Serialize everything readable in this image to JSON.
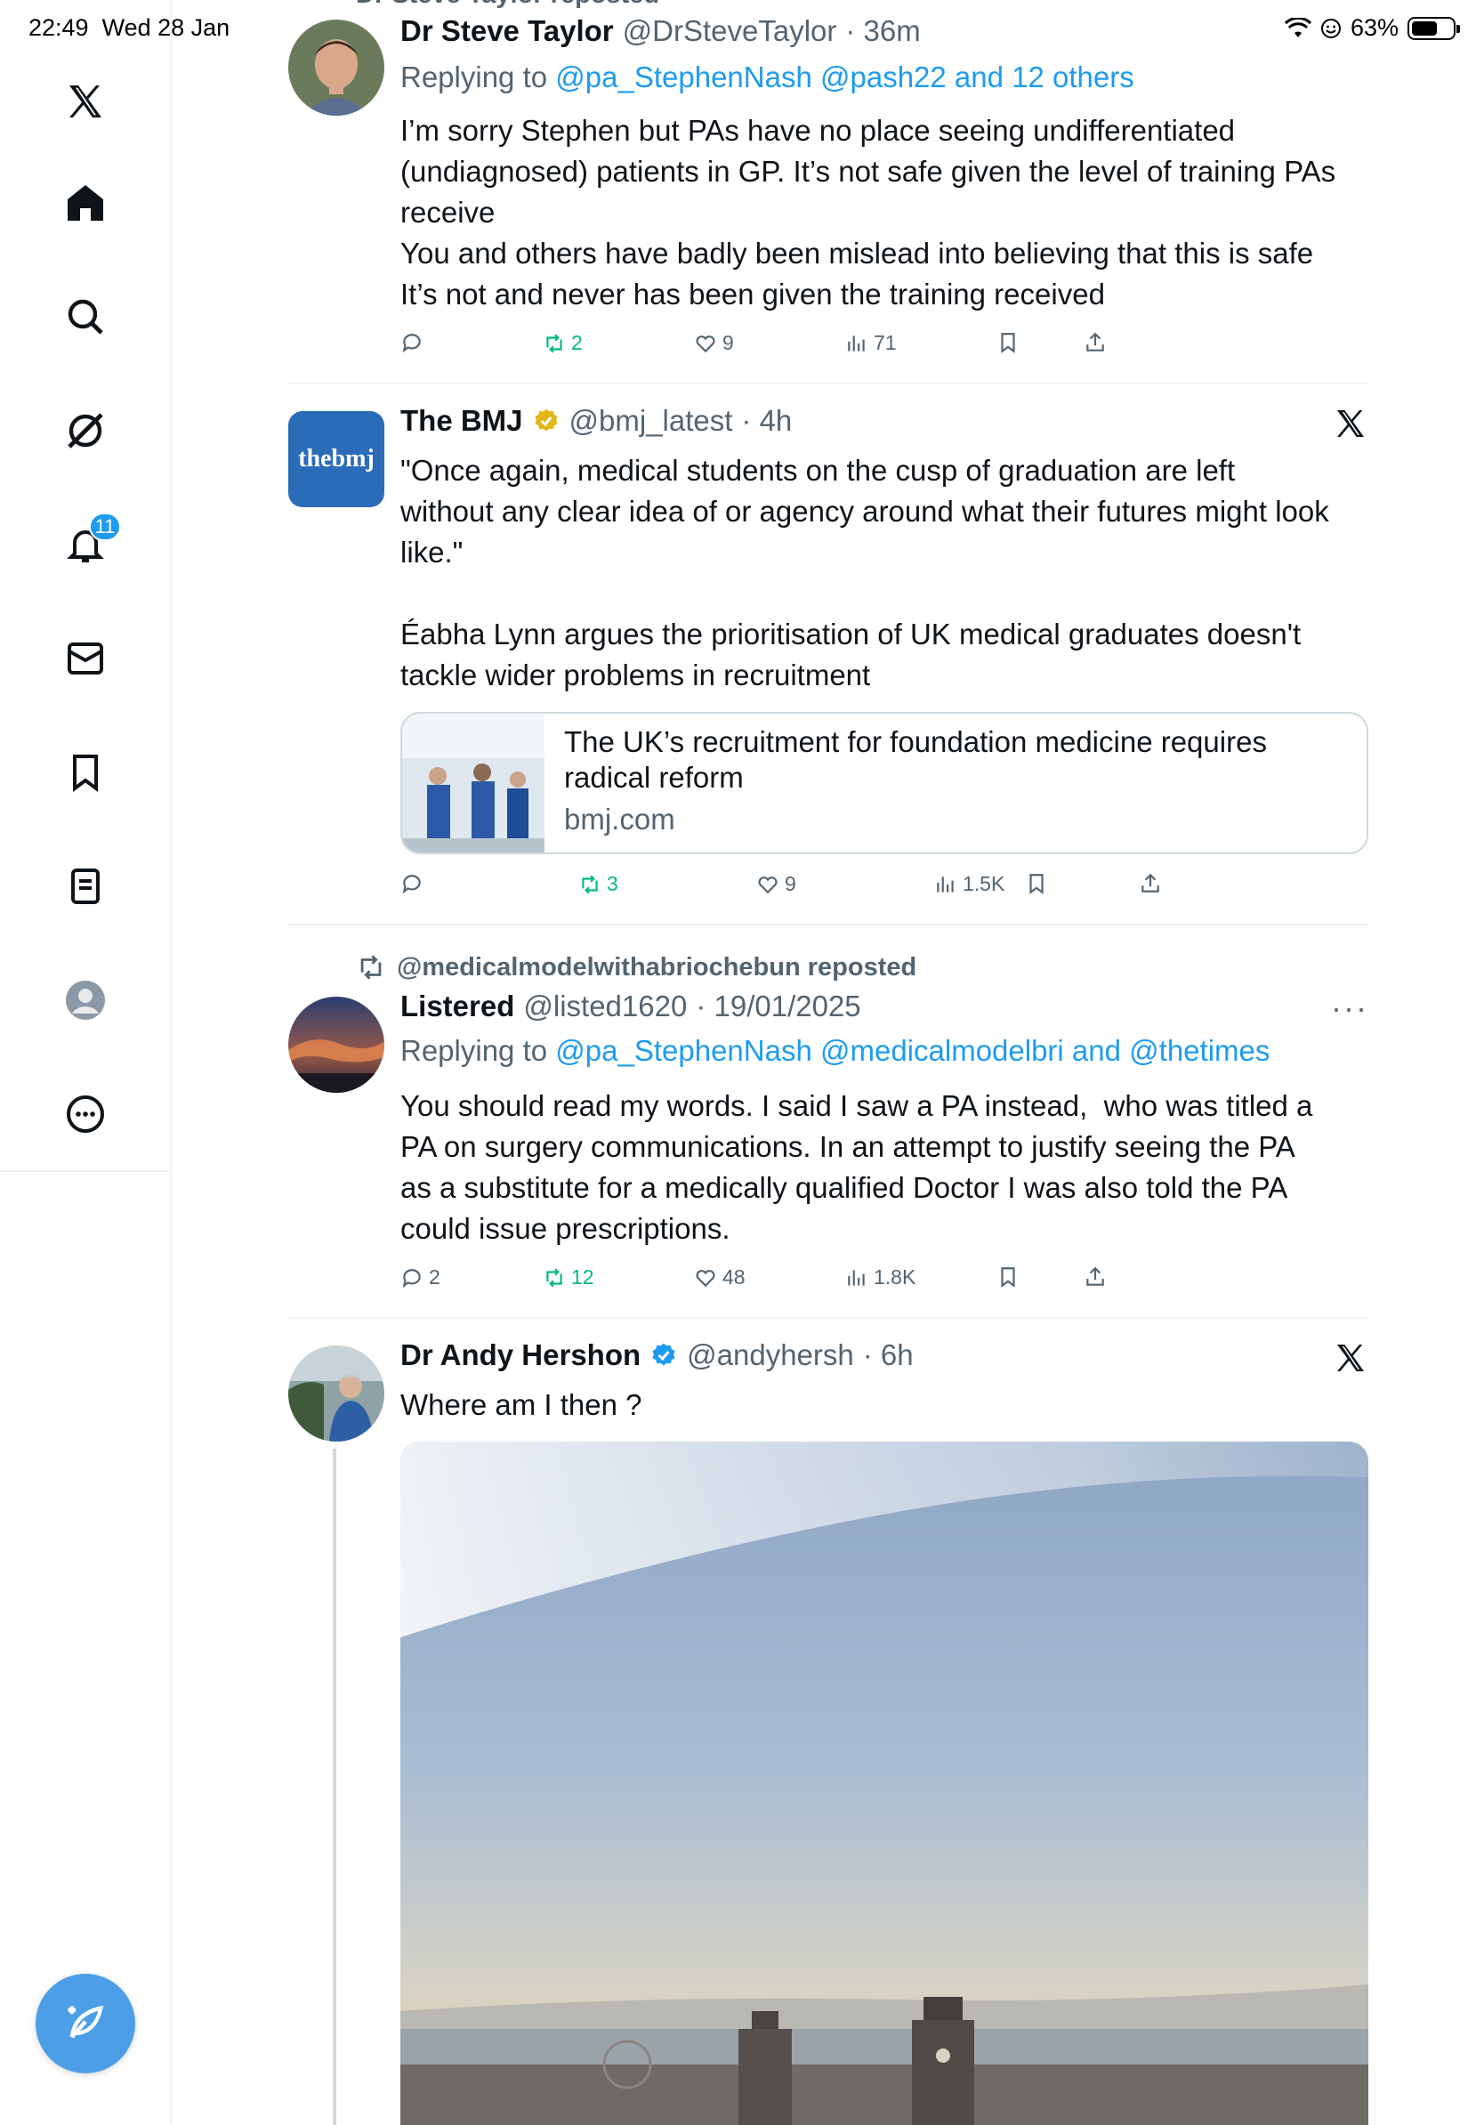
{
  "status": {
    "time": "22:49",
    "date": "Wed 28 Jan",
    "battery": "63%",
    "battery_level": 0.63
  },
  "sidebar": {
    "items": [
      {
        "name": "x-logo"
      },
      {
        "name": "home"
      },
      {
        "name": "search"
      },
      {
        "name": "grok"
      },
      {
        "name": "notifications",
        "badge": "11"
      },
      {
        "name": "messages"
      },
      {
        "name": "bookmarks"
      },
      {
        "name": "lists"
      },
      {
        "name": "profile"
      },
      {
        "name": "more"
      }
    ]
  },
  "tweets": [
    {
      "context": "Dr Steve Taylor reposted",
      "name": "Dr Steve Taylor",
      "handle": "@DrSteveTaylor",
      "time": "· 36m",
      "reply_prefix": "Replying to",
      "reply_to": "@pa_StephenNash @pash22 and 12 others",
      "text": "I’m sorry Stephen but PAs have no place seeing undifferentiated\n(undiagnosed) patients in GP. It’s not safe given the level of training PAs\nreceive\nYou and others have badly been mislead into believing that this is safe\nIt’s not and never has been given the training received",
      "replies": "",
      "reposts": "2",
      "likes": "9",
      "views": "71"
    },
    {
      "name": "The BMJ",
      "handle": "@bmj_latest",
      "time": "· 4h",
      "avatar_text": "thebmj",
      "text": "\"Once again, medical students on the cusp of graduation are left\nwithout any clear idea of or agency around what their futures might look\nlike.\"\n\nÉabha Lynn argues the prioritisation of UK medical graduates doesn't\ntackle wider problems in recruitment",
      "card_title": "The UK’s recruitment for foundation medicine requires radical reform",
      "card_domain": "bmj.com",
      "replies": "",
      "reposts": "3",
      "likes": "9",
      "views": "1.5K"
    },
    {
      "repost_by": "@medicalmodelwithabriochebun reposted",
      "name": "Listered",
      "handle": "@listed1620",
      "time": "· 19/01/2025",
      "reply_prefix": "Replying to",
      "reply_to": "@pa_StephenNash @medicalmodelbri and @thetimes",
      "text": "You should read my words. I said I saw a PA instead,  who was titled a\nPA on surgery communications. In an attempt to justify seeing the PA\nas a substitute for a medically qualified Doctor I was also told the PA\ncould issue prescriptions.",
      "replies": "2",
      "reposts": "12",
      "likes": "48",
      "views": "1.8K"
    },
    {
      "name": "Dr Andy Hershon",
      "handle": "@andyhersh",
      "time": "· 6h",
      "text": "Where am I then ?"
    }
  ],
  "colors": {
    "accent": "#1d9bf0",
    "repost_green": "#00ba7c",
    "secondary": "#536471"
  }
}
